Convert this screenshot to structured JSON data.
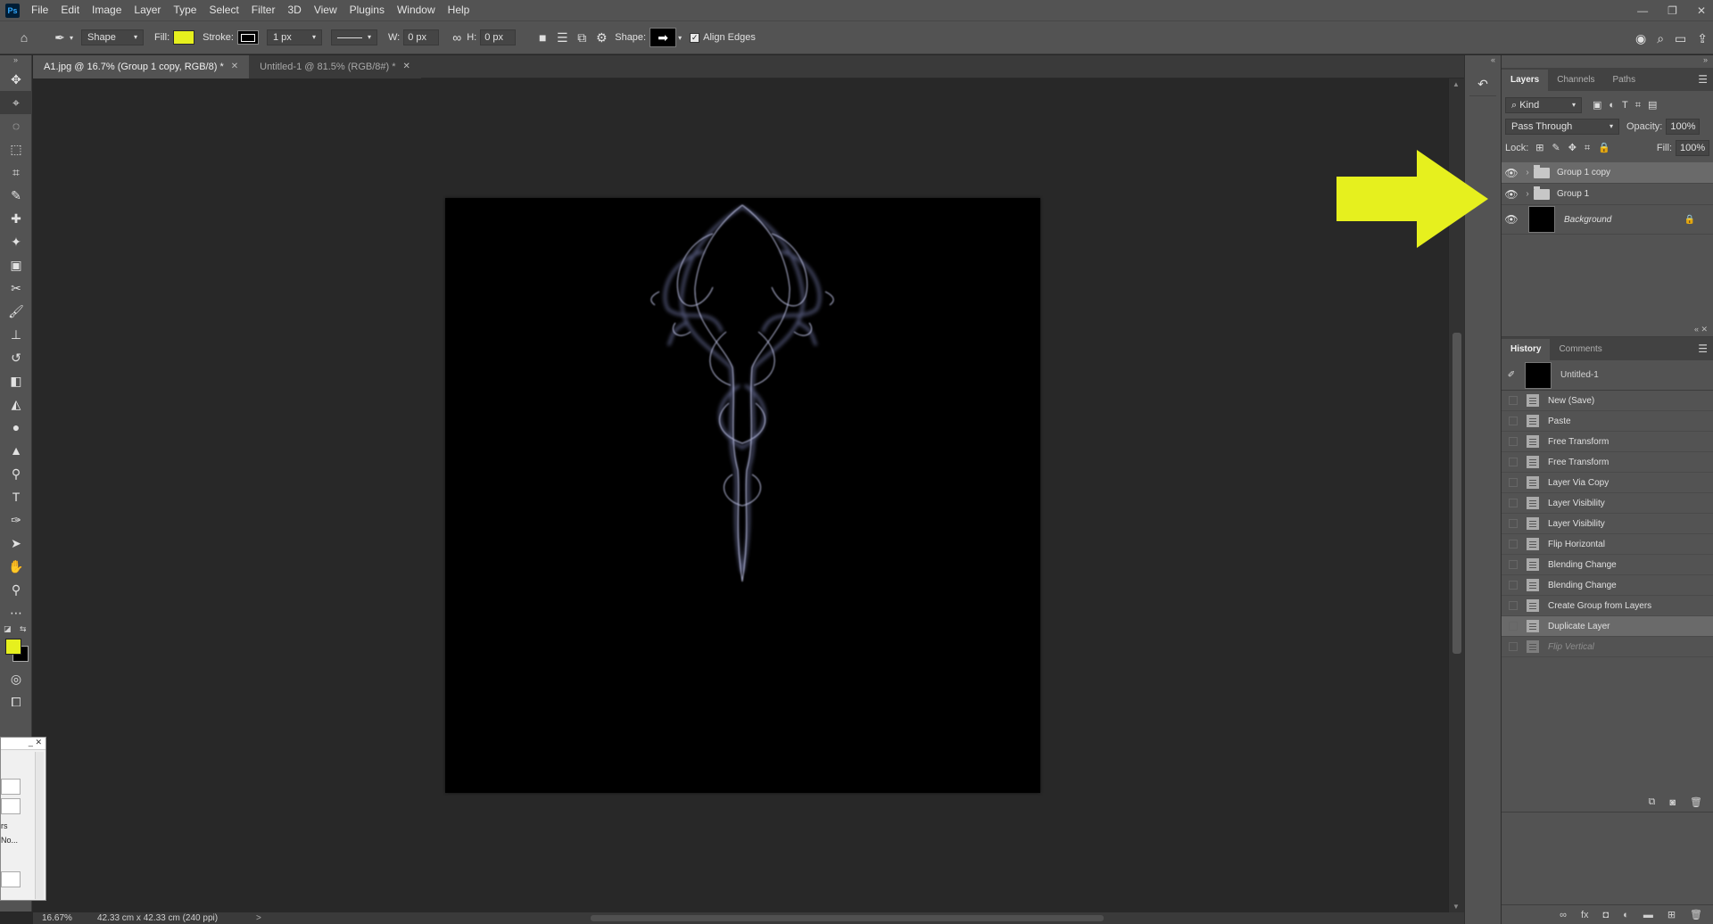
{
  "app": {
    "logo": "Ps"
  },
  "menu": [
    "File",
    "Edit",
    "Image",
    "Layer",
    "Type",
    "Select",
    "Filter",
    "3D",
    "View",
    "Plugins",
    "Window",
    "Help"
  ],
  "window_controls": {
    "minimize": "—",
    "restore": "❐",
    "close": "✕"
  },
  "options": {
    "mode": "Shape",
    "fill_label": "Fill:",
    "fill_color": "#e6f01e",
    "stroke_label": "Stroke:",
    "stroke_width": "1 px",
    "w_label": "W:",
    "w_value": "0 px",
    "h_label": "H:",
    "h_value": "0 px",
    "shape_label": "Shape:",
    "align_edges": "Align Edges"
  },
  "tabs": [
    {
      "label": "A1.jpg @ 16.7% (Group 1 copy, RGB/8) *",
      "active": true
    },
    {
      "label": "Untitled-1 @ 81.5% (RGB/8#) *",
      "active": false
    }
  ],
  "status": {
    "zoom": "16.67%",
    "doc_info": "42.33 cm x 42.33 cm (240 ppi)",
    "arrow": ">"
  },
  "float_dialog": {
    "line1": "rs",
    "line2": "No..."
  },
  "layers_panel": {
    "tabs": [
      "Layers",
      "Channels",
      "Paths"
    ],
    "filter_kind": "Kind",
    "blend_mode": "Pass Through",
    "opacity_label": "Opacity:",
    "opacity": "100%",
    "lock_label": "Lock:",
    "fill_label": "Fill:",
    "fill": "100%",
    "layers": [
      {
        "name": "Group 1 copy",
        "type": "group",
        "selected": true
      },
      {
        "name": "Group 1",
        "type": "group",
        "selected": false
      },
      {
        "name": "Background",
        "type": "background",
        "selected": false
      }
    ]
  },
  "history_panel": {
    "tabs": [
      "History",
      "Comments"
    ],
    "snapshot": "Untitled-1",
    "steps": [
      {
        "label": "New (Save)"
      },
      {
        "label": "Paste"
      },
      {
        "label": "Free Transform"
      },
      {
        "label": "Free Transform"
      },
      {
        "label": "Layer Via Copy"
      },
      {
        "label": "Layer Visibility"
      },
      {
        "label": "Layer Visibility"
      },
      {
        "label": "Flip Horizontal"
      },
      {
        "label": "Blending Change"
      },
      {
        "label": "Blending Change"
      },
      {
        "label": "Create Group from Layers"
      },
      {
        "label": "Duplicate Layer",
        "selected": true
      },
      {
        "label": "Flip Vertical",
        "undone": true
      }
    ]
  },
  "annotation": {
    "arrow_color": "#e6f01e"
  }
}
